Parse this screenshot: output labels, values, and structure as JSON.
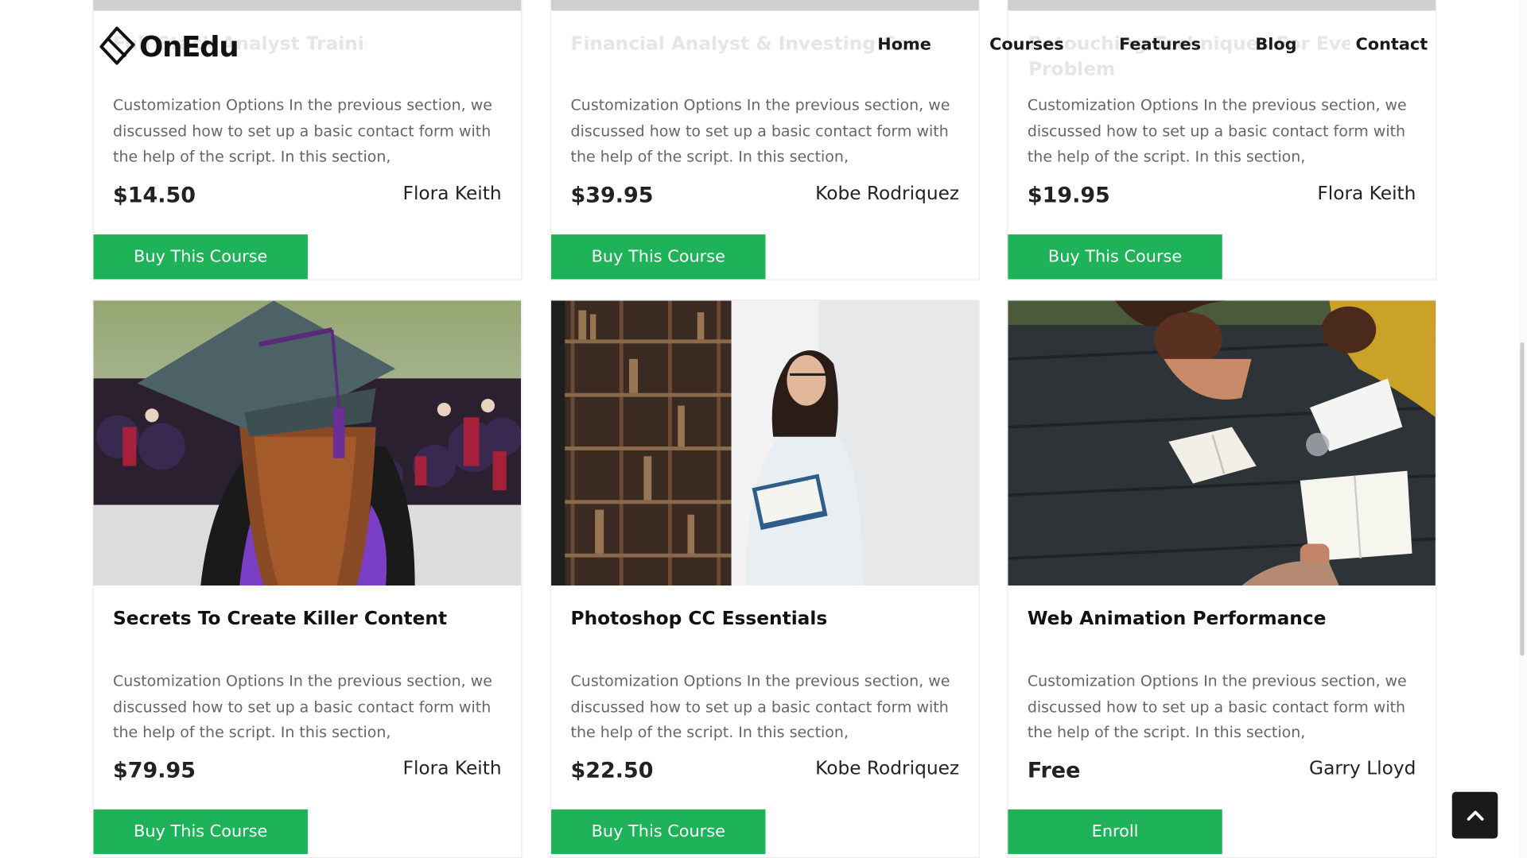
{
  "brand": {
    "name": "OnEdu"
  },
  "nav": {
    "items": [
      {
        "label": "Home"
      },
      {
        "label": "Courses"
      },
      {
        "label": "Features"
      },
      {
        "label": "Blog"
      },
      {
        "label": "Contact"
      }
    ]
  },
  "top_row": [
    {
      "ghost_title": "Full Stack Analyst Training",
      "description": "Customization Options In the previous section, we discussed how to set up a basic contact form with the help of the script. In this section,",
      "price": "$14.50",
      "author": "Flora Keith",
      "button": "Buy This Course"
    },
    {
      "ghost_title": "Financial Analyst & Investing Course",
      "description": "Customization Options In the previous section, we discussed how to set up a basic contact form with the help of the script. In this section,",
      "price": "$39.95",
      "author": "Kobe Rodriquez",
      "button": "Buy This Course"
    },
    {
      "ghost_title": "Retouching Techniques For Every",
      "ghost_title_2": "Problem",
      "description": "Customization Options In the previous section, we discussed how to set up a basic contact form with the help of the script. In this section,",
      "price": "$19.95",
      "author": "Flora Keith",
      "button": "Buy This Course"
    }
  ],
  "bottom_row": [
    {
      "title": "Secrets To Create Killer Content",
      "description": "Customization Options In the previous section, we discussed how to set up a basic contact form with the help of the script. In this section,",
      "price": "$79.95",
      "author": "Flora Keith",
      "button": "Buy This Course"
    },
    {
      "title": "Photoshop CC Essentials",
      "description": "Customization Options In the previous section, we discussed how to set up a basic contact form with the help of the script. In this section,",
      "price": "$22.50",
      "author": "Kobe Rodriquez",
      "button": "Buy This Course"
    },
    {
      "title": "Web Animation Performance",
      "description": "Customization Options In the previous section, we discussed how to set up a basic contact form with the help of the script. In this section,",
      "price": "Free",
      "author": "Garry Lloyd",
      "button": "Enroll"
    }
  ],
  "colors": {
    "accent": "#1eb358",
    "dark": "#1a1a1a"
  },
  "icons": {
    "scroll_top": "chevron-up-icon",
    "logo": "diamond-logo-icon"
  }
}
